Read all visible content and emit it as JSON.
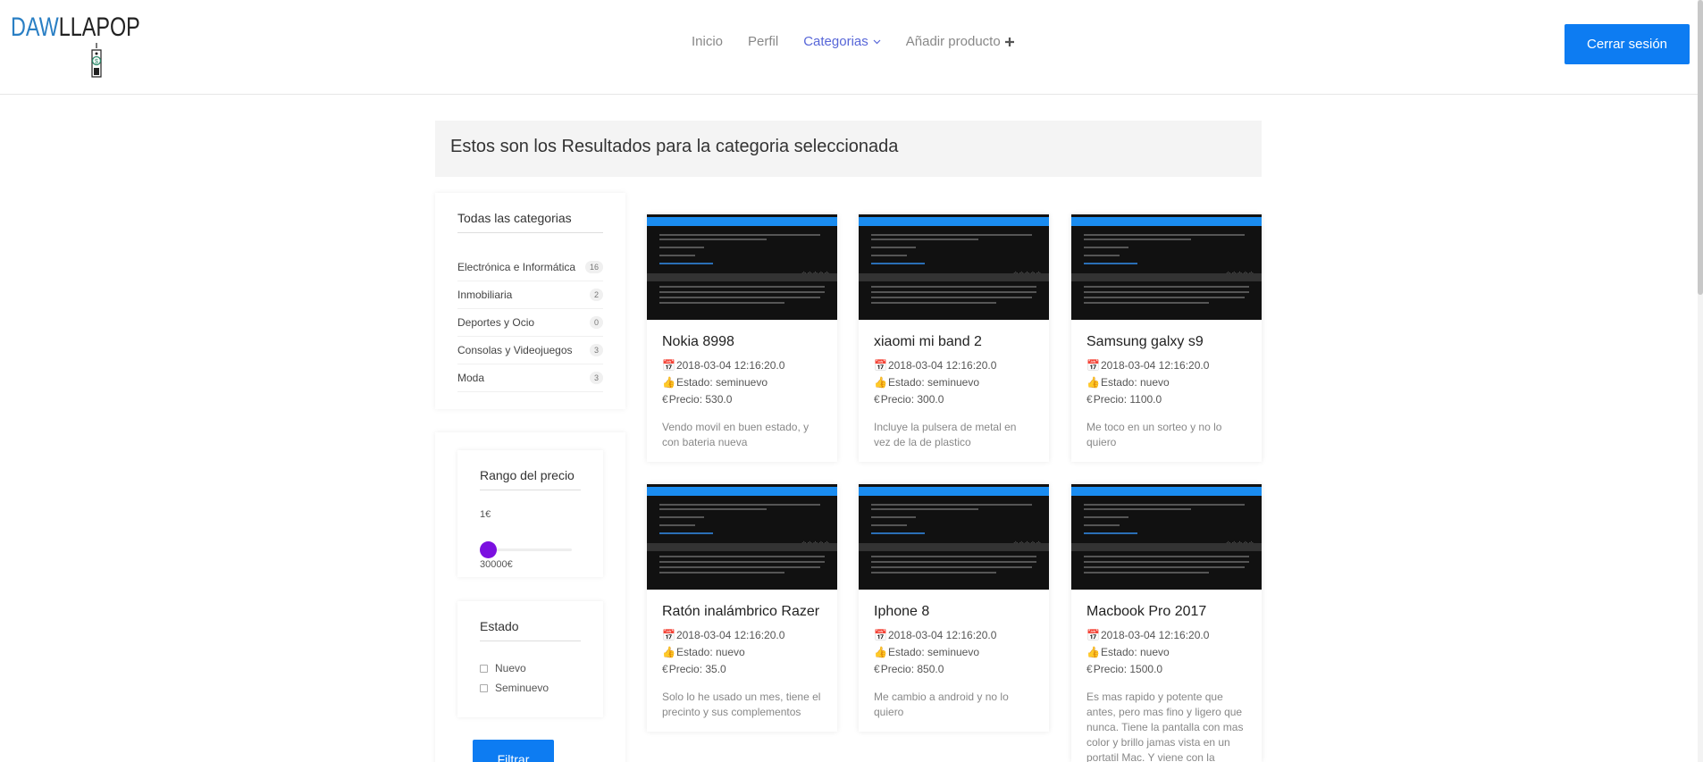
{
  "header": {
    "logo": {
      "part1": "DAW",
      "part2": "LLAPOP"
    },
    "nav": [
      {
        "label": "Inicio"
      },
      {
        "label": "Perfil"
      },
      {
        "label": "Categorias"
      },
      {
        "label": "Añadir producto"
      }
    ],
    "logout_label": "Cerrar sesión",
    "accent_color": "#5766d8",
    "button_color": "#0d7cf2"
  },
  "results": {
    "heading": "Estos son los Resultados para la categoria seleccionada"
  },
  "sidebar": {
    "categories_title": "Todas las categorias",
    "categories": [
      {
        "label": "Electrónica e Informática",
        "count": "16"
      },
      {
        "label": "Inmobiliaria",
        "count": "2"
      },
      {
        "label": "Deportes y Ocio",
        "count": "0"
      },
      {
        "label": "Consolas y Videojuegos",
        "count": "3"
      },
      {
        "label": "Moda",
        "count": "3"
      }
    ],
    "price": {
      "title": "Rango del precio",
      "min_label": "1€",
      "max_label": "30000€",
      "slider_position": 0
    },
    "state": {
      "title": "Estado",
      "options": [
        {
          "label": "Nuevo",
          "checked": false
        },
        {
          "label": "Seminuevo",
          "checked": false
        }
      ]
    },
    "filter_label": "Filtrar",
    "slider_color": "#7b10e0"
  },
  "products": [
    {
      "title": "Nokia 8998",
      "date": "2018-03-04 12:16:20.0",
      "state": "Estado: seminuevo",
      "price": "Precio: 530.0",
      "desc": "Vendo movil en buen estado, y con bateria nueva"
    },
    {
      "title": "xiaomi mi band 2",
      "date": "2018-03-04 12:16:20.0",
      "state": "Estado: seminuevo",
      "price": "Precio: 300.0",
      "desc": "Incluye la pulsera de metal en vez de la de plastico"
    },
    {
      "title": "Samsung galxy s9",
      "date": "2018-03-04 12:16:20.0",
      "state": "Estado: nuevo",
      "price": "Precio: 1100.0",
      "desc": "Me toco en un sorteo y no lo quiero"
    },
    {
      "title": "Ratón inalámbrico Razer",
      "date": "2018-03-04 12:16:20.0",
      "state": "Estado: nuevo",
      "price": "Precio: 35.0",
      "desc": "Solo lo he usado un mes, tiene el precinto y sus complementos"
    },
    {
      "title": "Iphone 8",
      "date": "2018-03-04 12:16:20.0",
      "state": "Estado: seminuevo",
      "price": "Precio: 850.0",
      "desc": "Me cambio a android y no lo quiero"
    },
    {
      "title": "Macbook Pro 2017",
      "date": "2018-03-04 12:16:20.0",
      "state": "Estado: nuevo",
      "price": "Precio: 1500.0",
      "desc": "Es mas rapido y potente que antes, pero mas fino y ligero que nunca. Tiene la pantalla con mas color y brillo jamas vista en un portatil Mac. Y viene con la"
    }
  ]
}
